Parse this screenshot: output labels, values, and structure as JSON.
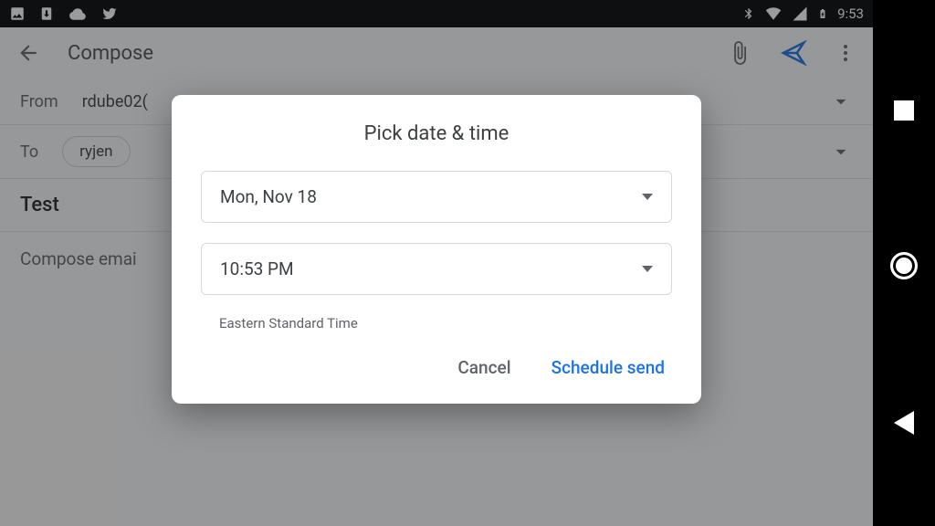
{
  "status_bar": {
    "clock": "9:53"
  },
  "appbar": {
    "title": "Compose",
    "icons": {
      "attach": "attach",
      "send": "send",
      "more": "more"
    }
  },
  "compose": {
    "from_label": "From",
    "from_value": "rdube02(",
    "to_label": "To",
    "to_chip": "ryjen",
    "subject": "Test",
    "body_placeholder": "Compose emai"
  },
  "dialog": {
    "title": "Pick date & time",
    "date_value": "Mon, Nov 18",
    "time_value": "10:53 PM",
    "timezone": "Eastern Standard Time",
    "cancel_label": "Cancel",
    "confirm_label": "Schedule send"
  }
}
